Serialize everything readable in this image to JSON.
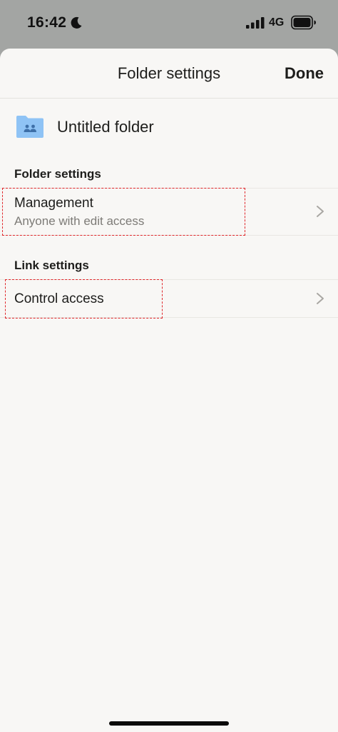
{
  "status_bar": {
    "time": "16:42",
    "network": "4G",
    "icons": [
      "moon-icon",
      "signal-icon",
      "battery-icon"
    ]
  },
  "nav": {
    "title": "Folder settings",
    "done_label": "Done"
  },
  "folder": {
    "name": "Untitled folder",
    "icon": "shared-folder-icon",
    "icon_color": "#8fc3f5"
  },
  "sections": {
    "folder_settings": {
      "header": "Folder settings",
      "management": {
        "title": "Management",
        "subtitle": "Anyone with edit access"
      }
    },
    "link_settings": {
      "header": "Link settings",
      "control_access": {
        "title": "Control access"
      }
    }
  },
  "colors": {
    "sheet_background": "#f8f7f5",
    "backdrop": "#a3a5a3",
    "highlight_border": "#e0262a",
    "secondary_text": "#7d7b77"
  }
}
